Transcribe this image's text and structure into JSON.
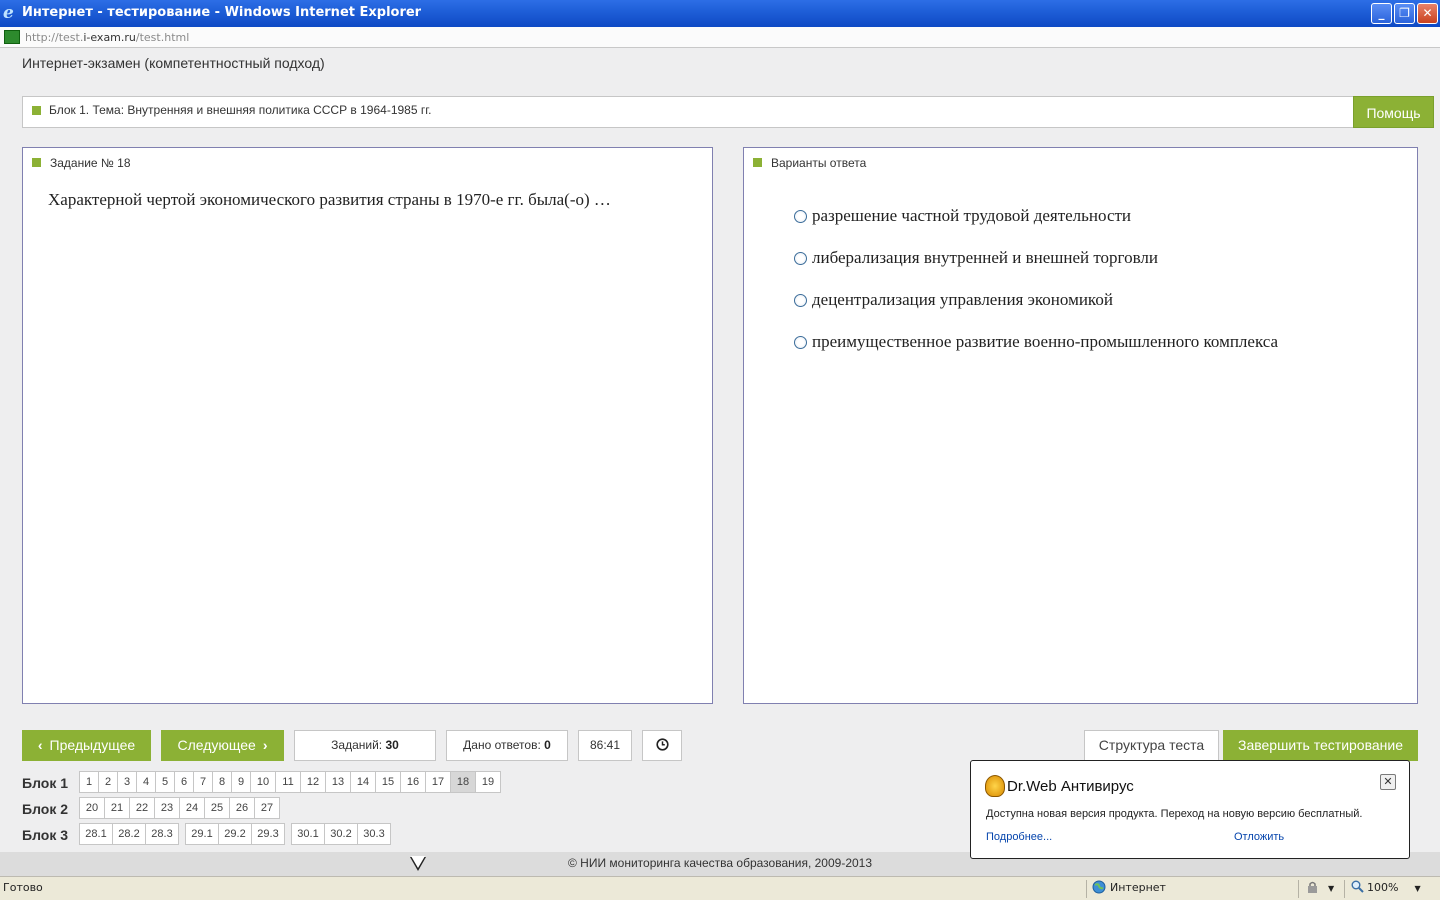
{
  "window": {
    "title": "Интернет - тестирование - Windows Internet Explorer",
    "minimize_glyph": "_",
    "restore_glyph": "❐",
    "close_glyph": "✕"
  },
  "address": {
    "prefix": "http://test.",
    "host": "i-exam.ru",
    "path": "/test.html"
  },
  "exam": {
    "title": "Интернет-экзамен (компетентностный подход)",
    "topic": "Блок 1. Тема: Внутренняя и внешняя политика СССР в 1964-1985 гг.",
    "help_label": "Помощь"
  },
  "task": {
    "heading": "Задание № 18",
    "question": "Характерной чертой экономического развития страны в 1970-е гг. была(-о) …"
  },
  "answers": {
    "heading": "Варианты ответа",
    "options": [
      "разрешение частной трудовой деятельности",
      "либерализация внутренней и внешней торговли",
      "децентрализация управления экономикой",
      "преимущественное развитие военно-промышленного комплекса"
    ]
  },
  "toolbar": {
    "prev_label": "Предыдущее",
    "next_label": "Следующее",
    "tasks_label": "Заданий:",
    "tasks_value": "30",
    "answered_label": "Дано ответов:",
    "answered_value": "0",
    "timer": "86:41",
    "structure_label": "Структура теста",
    "finish_label": "Завершить тестирование"
  },
  "blocks": [
    {
      "label": "Блок 1",
      "items": [
        "1",
        "2",
        "3",
        "4",
        "5",
        "6",
        "7",
        "8",
        "9",
        "10",
        "11",
        "12",
        "13",
        "14",
        "15",
        "16",
        "17",
        "18",
        "19"
      ],
      "current": "18"
    },
    {
      "label": "Блок 2",
      "items": [
        "20",
        "21",
        "22",
        "23",
        "24",
        "25",
        "26",
        "27"
      ]
    },
    {
      "label": "Блок 3",
      "groups": [
        [
          "28.1",
          "28.2",
          "28.3"
        ],
        [
          "29.1",
          "29.2",
          "29.3"
        ],
        [
          "30.1",
          "30.2",
          "30.3"
        ]
      ]
    }
  ],
  "footer": "© НИИ мониторинга качества образования, 2009-2013",
  "status": {
    "left": "Готово",
    "zone": "Интернет",
    "zoom": "100%"
  },
  "drweb": {
    "title": "Dr.Web Антивирус",
    "message": "Доступна новая версия продукта. Переход на новую версию бесплатный.",
    "more_link": "Подробнее...",
    "later_link": "Отложить",
    "close_glyph": "✕"
  },
  "colors": {
    "accent_green": "#8cb135",
    "titlebar_blue": "#1f5fd8",
    "panel_border": "#8080b0"
  }
}
